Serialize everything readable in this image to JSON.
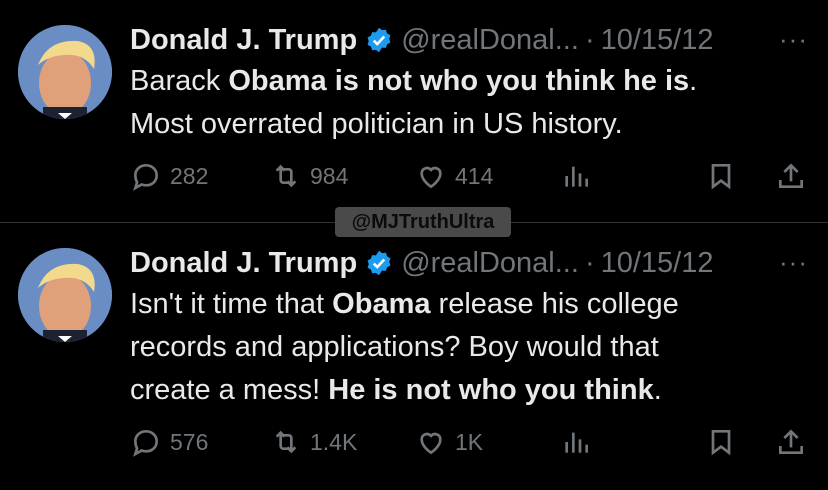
{
  "tweets": [
    {
      "author": {
        "name": "Donald J. Trump",
        "handle": "@realDonal...",
        "date": "10/15/12"
      },
      "text_parts": [
        "Barack ",
        "Obama is not who you think he is",
        ".",
        "Most overrated politician in US history."
      ],
      "metrics": {
        "replies": "282",
        "retweets": "984",
        "likes": "414"
      },
      "more_label": "···"
    },
    {
      "author": {
        "name": "Donald J. Trump",
        "handle": "@realDonal...",
        "date": "10/15/12"
      },
      "text_parts": [
        "Isn't it time that ",
        "Obama",
        " release his college",
        "records and applications? Boy would that",
        "create a mess! ",
        "He is not who you think",
        "."
      ],
      "metrics": {
        "replies": "576",
        "retweets": "1.4K",
        "likes": "1K"
      },
      "more_label": "···"
    }
  ],
  "watermark": "@MJTruthUltra",
  "colors": {
    "background": "#000000",
    "text": "#e7e9ea",
    "muted": "#71767b",
    "verified": "#1d9bf0"
  },
  "icons": [
    "verified-badge-icon",
    "reply-icon",
    "retweet-icon",
    "like-icon",
    "views-icon",
    "bookmark-icon",
    "share-icon",
    "more-icon"
  ]
}
